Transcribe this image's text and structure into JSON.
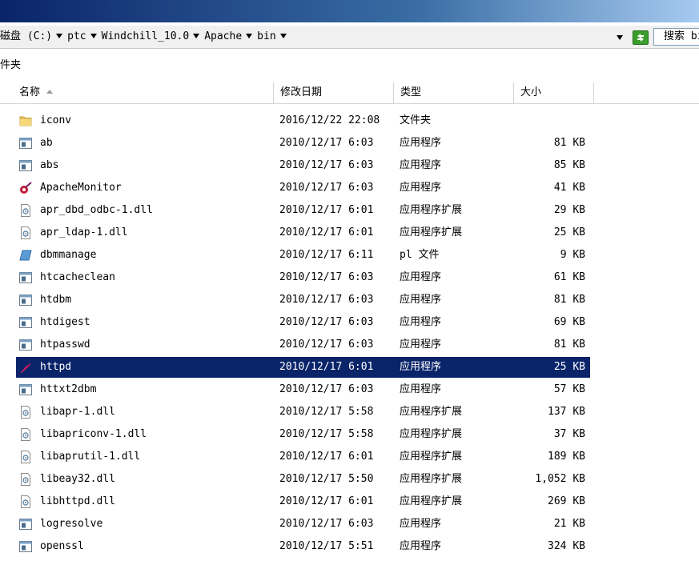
{
  "address": {
    "crumbs": [
      "磁盘 (C:)",
      "ptc",
      "Windchill_10.0",
      "Apache",
      "bin"
    ],
    "search_label": "搜索 bin"
  },
  "nav": {
    "label": "件夹"
  },
  "columns": {
    "name": "名称",
    "date": "修改日期",
    "type": "类型",
    "size": "大小"
  },
  "files": [
    {
      "name": "iconv",
      "date": "2016/12/22 22:08",
      "type": "文件夹",
      "size": "",
      "icon": "folder"
    },
    {
      "name": "ab",
      "date": "2010/12/17 6:03",
      "type": "应用程序",
      "size": "81 KB",
      "icon": "exe"
    },
    {
      "name": "abs",
      "date": "2010/12/17 6:03",
      "type": "应用程序",
      "size": "85 KB",
      "icon": "exe"
    },
    {
      "name": "ApacheMonitor",
      "date": "2010/12/17 6:03",
      "type": "应用程序",
      "size": "41 KB",
      "icon": "apache-monitor"
    },
    {
      "name": "apr_dbd_odbc-1.dll",
      "date": "2010/12/17 6:01",
      "type": "应用程序扩展",
      "size": "29 KB",
      "icon": "dll"
    },
    {
      "name": "apr_ldap-1.dll",
      "date": "2010/12/17 6:01",
      "type": "应用程序扩展",
      "size": "25 KB",
      "icon": "dll"
    },
    {
      "name": "dbmmanage",
      "date": "2010/12/17 6:11",
      "type": "pl 文件",
      "size": "9 KB",
      "icon": "script"
    },
    {
      "name": "htcacheclean",
      "date": "2010/12/17 6:03",
      "type": "应用程序",
      "size": "61 KB",
      "icon": "exe"
    },
    {
      "name": "htdbm",
      "date": "2010/12/17 6:03",
      "type": "应用程序",
      "size": "81 KB",
      "icon": "exe"
    },
    {
      "name": "htdigest",
      "date": "2010/12/17 6:03",
      "type": "应用程序",
      "size": "69 KB",
      "icon": "exe"
    },
    {
      "name": "htpasswd",
      "date": "2010/12/17 6:03",
      "type": "应用程序",
      "size": "81 KB",
      "icon": "exe"
    },
    {
      "name": "httpd",
      "date": "2010/12/17 6:01",
      "type": "应用程序",
      "size": "25 KB",
      "icon": "feather",
      "selected": true
    },
    {
      "name": "httxt2dbm",
      "date": "2010/12/17 6:03",
      "type": "应用程序",
      "size": "57 KB",
      "icon": "exe"
    },
    {
      "name": "libapr-1.dll",
      "date": "2010/12/17 5:58",
      "type": "应用程序扩展",
      "size": "137 KB",
      "icon": "dll"
    },
    {
      "name": "libapriconv-1.dll",
      "date": "2010/12/17 5:58",
      "type": "应用程序扩展",
      "size": "37 KB",
      "icon": "dll"
    },
    {
      "name": "libaprutil-1.dll",
      "date": "2010/12/17 6:01",
      "type": "应用程序扩展",
      "size": "189 KB",
      "icon": "dll"
    },
    {
      "name": "libeay32.dll",
      "date": "2010/12/17 5:50",
      "type": "应用程序扩展",
      "size": "1,052 KB",
      "icon": "dll"
    },
    {
      "name": "libhttpd.dll",
      "date": "2010/12/17 6:01",
      "type": "应用程序扩展",
      "size": "269 KB",
      "icon": "dll"
    },
    {
      "name": "logresolve",
      "date": "2010/12/17 6:03",
      "type": "应用程序",
      "size": "21 KB",
      "icon": "exe"
    },
    {
      "name": "openssl",
      "date": "2010/12/17 5:51",
      "type": "应用程序",
      "size": "324 KB",
      "icon": "exe"
    }
  ]
}
